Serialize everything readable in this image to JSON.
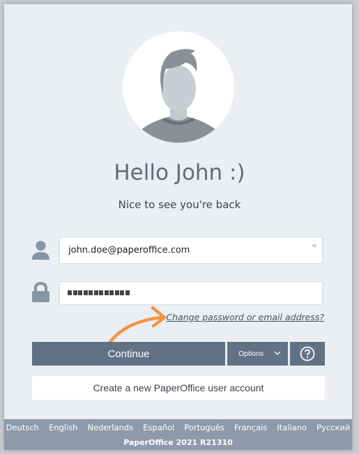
{
  "greeting": {
    "title": "Hello John :)",
    "subtitle": "Nice to see you're back"
  },
  "form": {
    "email_value": "john.doe@paperoffice.com",
    "password_masked_length": 12,
    "change_link": "Change password or email address?"
  },
  "buttons": {
    "continue": "Continue",
    "options": "Options",
    "create_account": "Create a new PaperOffice user account"
  },
  "icons": {
    "user": "user-icon",
    "lock": "lock-icon",
    "help": "question-circle-icon",
    "options": "chevron-down-icon",
    "email_dropdown": "caret-down-icon"
  },
  "footer": {
    "languages": [
      "Deutsch",
      "English",
      "Nederlands",
      "Español",
      "Português",
      "Français",
      "Italiano",
      "Русский"
    ],
    "version": "PaperOffice 2021 R21310"
  },
  "colors": {
    "accent": "#617285",
    "arrow": "#f39443",
    "footer": "#8c9aab",
    "background": "#ebeef3"
  }
}
